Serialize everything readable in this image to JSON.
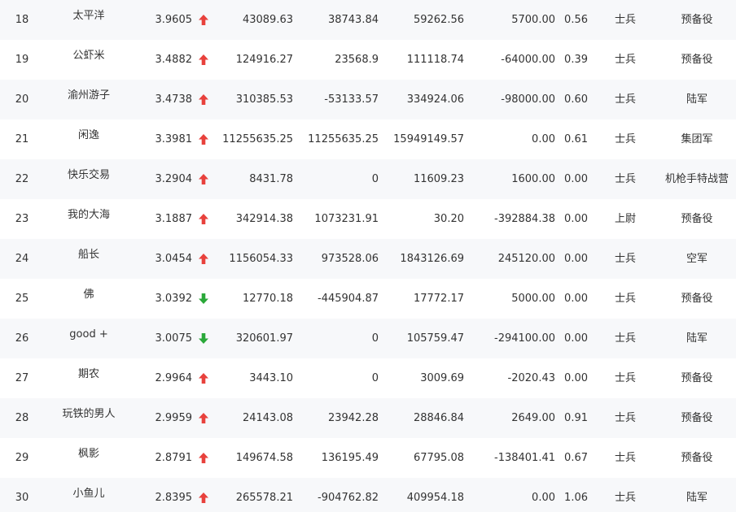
{
  "colors": {
    "up": "#e8413c",
    "down": "#2aa839"
  },
  "rows": [
    {
      "rank": "18",
      "name": "太平洋",
      "score": "3.9605",
      "trend": "up",
      "v1": "43089.63",
      "v2": "38743.84",
      "v3": "59262.56",
      "v4": "5700.00",
      "ratio": "0.56",
      "grade": "士兵",
      "army": "预备役"
    },
    {
      "rank": "19",
      "name": "公虾米",
      "score": "3.4882",
      "trend": "up",
      "v1": "124916.27",
      "v2": "23568.9",
      "v3": "111118.74",
      "v4": "-64000.00",
      "ratio": "0.39",
      "grade": "士兵",
      "army": "预备役"
    },
    {
      "rank": "20",
      "name": "渝州游子",
      "score": "3.4738",
      "trend": "up",
      "v1": "310385.53",
      "v2": "-53133.57",
      "v3": "334924.06",
      "v4": "-98000.00",
      "ratio": "0.60",
      "grade": "士兵",
      "army": "陆军"
    },
    {
      "rank": "21",
      "name": "闲逸",
      "score": "3.3981",
      "trend": "up",
      "v1": "11255635.25",
      "v2": "11255635.25",
      "v3": "15949149.57",
      "v4": "0.00",
      "ratio": "0.61",
      "grade": "士兵",
      "army": "集团军"
    },
    {
      "rank": "22",
      "name": "快乐交易",
      "score": "3.2904",
      "trend": "up",
      "v1": "8431.78",
      "v2": "0",
      "v3": "11609.23",
      "v4": "1600.00",
      "ratio": "0.00",
      "grade": "士兵",
      "army": "机枪手特战营"
    },
    {
      "rank": "23",
      "name": "我的大海",
      "score": "3.1887",
      "trend": "up",
      "v1": "342914.38",
      "v2": "1073231.91",
      "v3": "30.20",
      "v4": "-392884.38",
      "ratio": "0.00",
      "grade": "上尉",
      "army": "预备役"
    },
    {
      "rank": "24",
      "name": "船长",
      "score": "3.0454",
      "trend": "up",
      "v1": "1156054.33",
      "v2": "973528.06",
      "v3": "1843126.69",
      "v4": "245120.00",
      "ratio": "0.00",
      "grade": "士兵",
      "army": "空军"
    },
    {
      "rank": "25",
      "name": "佛",
      "score": "3.0392",
      "trend": "down",
      "v1": "12770.18",
      "v2": "-445904.87",
      "v3": "17772.17",
      "v4": "5000.00",
      "ratio": "0.00",
      "grade": "士兵",
      "army": "预备役"
    },
    {
      "rank": "26",
      "name": "good +",
      "score": "3.0075",
      "trend": "down",
      "v1": "320601.97",
      "v2": "0",
      "v3": "105759.47",
      "v4": "-294100.00",
      "ratio": "0.00",
      "grade": "士兵",
      "army": "陆军"
    },
    {
      "rank": "27",
      "name": "期农",
      "score": "2.9964",
      "trend": "up",
      "v1": "3443.10",
      "v2": "0",
      "v3": "3009.69",
      "v4": "-2020.43",
      "ratio": "0.00",
      "grade": "士兵",
      "army": "预备役"
    },
    {
      "rank": "28",
      "name": "玩铁的男人",
      "score": "2.9959",
      "trend": "up",
      "v1": "24143.08",
      "v2": "23942.28",
      "v3": "28846.84",
      "v4": "2649.00",
      "ratio": "0.91",
      "grade": "士兵",
      "army": "预备役"
    },
    {
      "rank": "29",
      "name": "枫影",
      "score": "2.8791",
      "trend": "up",
      "v1": "149674.58",
      "v2": "136195.49",
      "v3": "67795.08",
      "v4": "-138401.41",
      "ratio": "0.67",
      "grade": "士兵",
      "army": "预备役"
    },
    {
      "rank": "30",
      "name": "小鱼儿",
      "score": "2.8395",
      "trend": "up",
      "v1": "265578.21",
      "v2": "-904762.82",
      "v3": "409954.18",
      "v4": "0.00",
      "ratio": "1.06",
      "grade": "士兵",
      "army": "陆军"
    }
  ]
}
